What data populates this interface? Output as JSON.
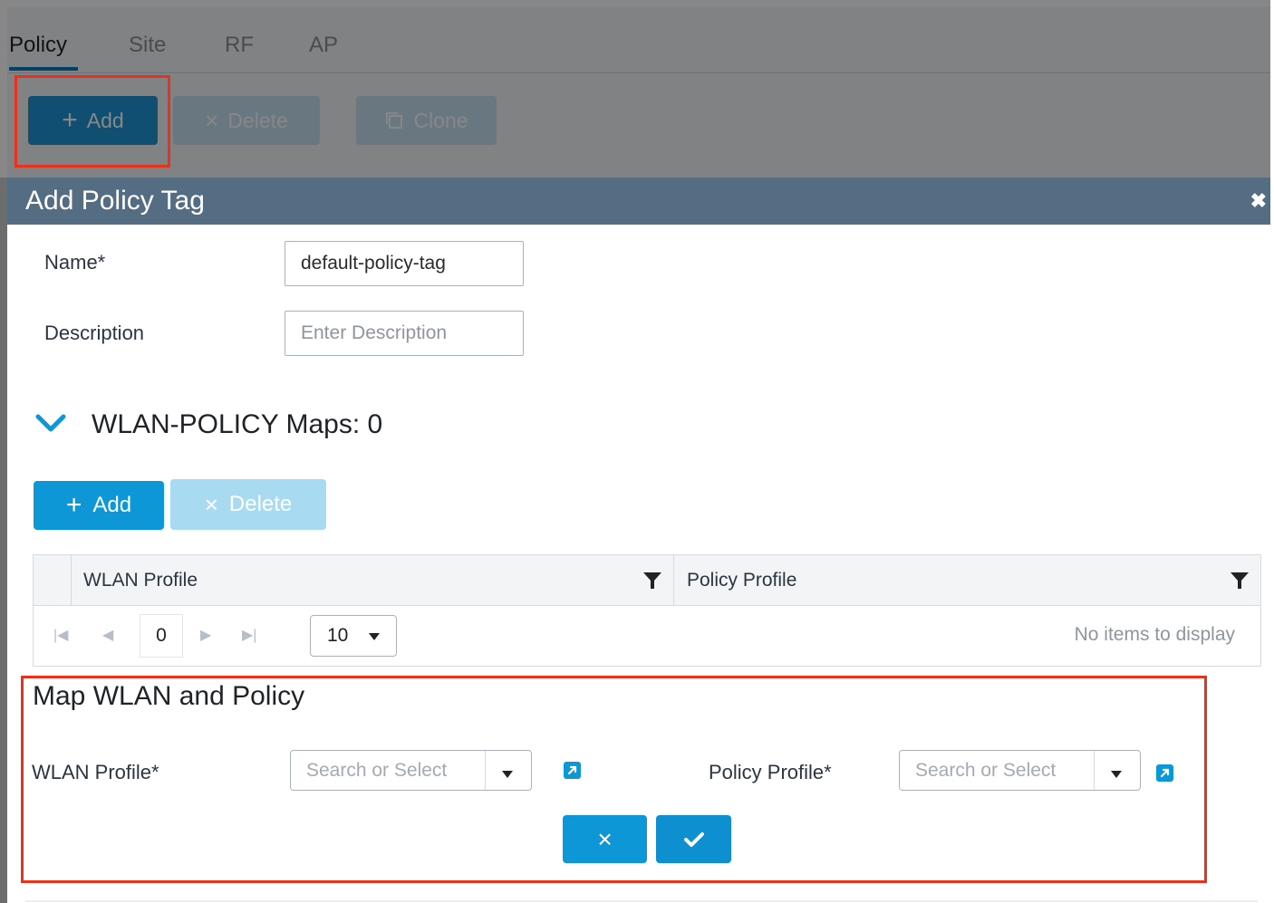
{
  "background": {
    "tabs": [
      "Policy",
      "Site",
      "RF",
      "AP"
    ],
    "active_tab": "Policy",
    "toolbar": {
      "add_label": "Add",
      "delete_label": "Delete",
      "clone_label": "Clone"
    }
  },
  "modal": {
    "title": "Add Policy Tag",
    "close_icon": "close-icon",
    "name_label": "Name*",
    "name_value": "default-policy-tag",
    "description_label": "Description",
    "description_placeholder": "Enter Description",
    "section_title": "WLAN-POLICY Maps: 0",
    "add_label": "Add",
    "delete_label": "Delete",
    "table": {
      "columns": [
        "WLAN Profile",
        "Policy Profile"
      ],
      "page": "0",
      "page_size": "10",
      "empty_text": "No items to display"
    },
    "map": {
      "title": "Map WLAN and Policy",
      "wlan_label": "WLAN Profile*",
      "wlan_placeholder": "Search or Select",
      "policy_label": "Policy Profile*",
      "policy_placeholder": "Search or Select"
    }
  },
  "colors": {
    "header": "#546d83",
    "primary": "#0d97d6",
    "disabled": "#a8dbf1",
    "highlight": "#e8321e"
  }
}
